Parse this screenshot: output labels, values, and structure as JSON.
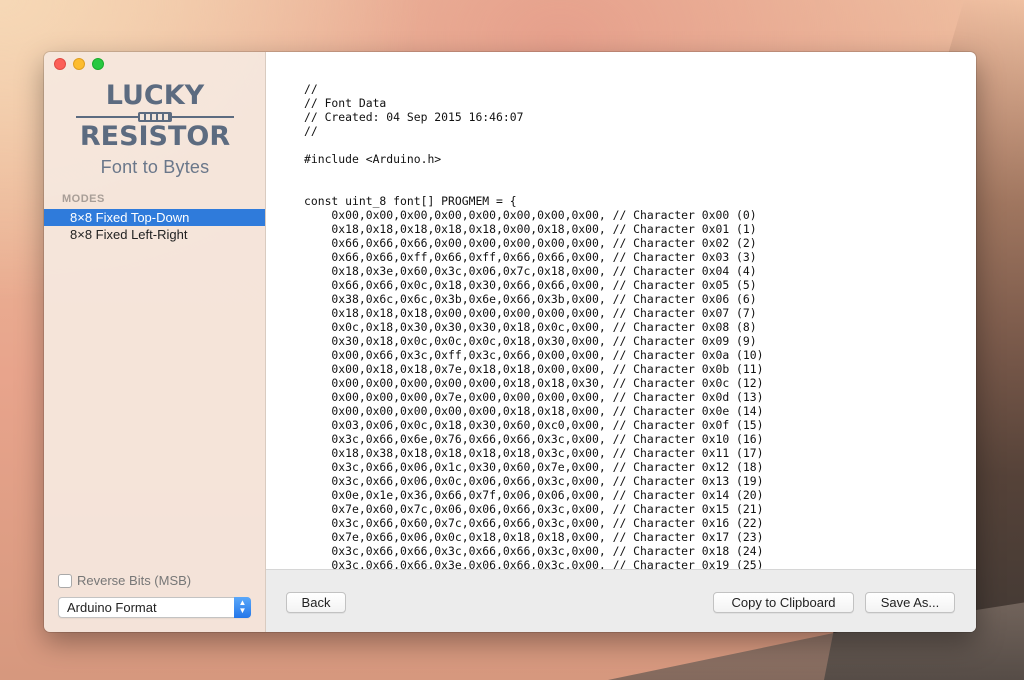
{
  "logo": {
    "line1": "LUCKY",
    "line2": "RESISTOR",
    "subtitle": "Font to Bytes"
  },
  "sidebar": {
    "modes_heading": "MODES",
    "modes": [
      {
        "label": "8×8 Fixed Top-Down",
        "selected": true
      },
      {
        "label": "8×8 Fixed Left-Right",
        "selected": false
      }
    ],
    "reverse_bits_label": "Reverse Bits (MSB)",
    "reverse_bits_checked": false,
    "format_value": "Arduino Format"
  },
  "code_lines": [
    "//",
    "// Font Data",
    "// Created: 04 Sep 2015 16:46:07",
    "//",
    "",
    "#include <Arduino.h>",
    "",
    "",
    "const uint_8 font[] PROGMEM = {",
    "    0x00,0x00,0x00,0x00,0x00,0x00,0x00,0x00, // Character 0x00 (0)",
    "    0x18,0x18,0x18,0x18,0x18,0x00,0x18,0x00, // Character 0x01 (1)",
    "    0x66,0x66,0x66,0x00,0x00,0x00,0x00,0x00, // Character 0x02 (2)",
    "    0x66,0x66,0xff,0x66,0xff,0x66,0x66,0x00, // Character 0x03 (3)",
    "    0x18,0x3e,0x60,0x3c,0x06,0x7c,0x18,0x00, // Character 0x04 (4)",
    "    0x66,0x66,0x0c,0x18,0x30,0x66,0x66,0x00, // Character 0x05 (5)",
    "    0x38,0x6c,0x6c,0x3b,0x6e,0x66,0x3b,0x00, // Character 0x06 (6)",
    "    0x18,0x18,0x18,0x00,0x00,0x00,0x00,0x00, // Character 0x07 (7)",
    "    0x0c,0x18,0x30,0x30,0x30,0x18,0x0c,0x00, // Character 0x08 (8)",
    "    0x30,0x18,0x0c,0x0c,0x0c,0x18,0x30,0x00, // Character 0x09 (9)",
    "    0x00,0x66,0x3c,0xff,0x3c,0x66,0x00,0x00, // Character 0x0a (10)",
    "    0x00,0x18,0x18,0x7e,0x18,0x18,0x00,0x00, // Character 0x0b (11)",
    "    0x00,0x00,0x00,0x00,0x00,0x18,0x18,0x30, // Character 0x0c (12)",
    "    0x00,0x00,0x00,0x7e,0x00,0x00,0x00,0x00, // Character 0x0d (13)",
    "    0x00,0x00,0x00,0x00,0x00,0x18,0x18,0x00, // Character 0x0e (14)",
    "    0x03,0x06,0x0c,0x18,0x30,0x60,0xc0,0x00, // Character 0x0f (15)",
    "    0x3c,0x66,0x6e,0x76,0x66,0x66,0x3c,0x00, // Character 0x10 (16)",
    "    0x18,0x38,0x18,0x18,0x18,0x18,0x3c,0x00, // Character 0x11 (17)",
    "    0x3c,0x66,0x06,0x1c,0x30,0x60,0x7e,0x00, // Character 0x12 (18)",
    "    0x3c,0x66,0x06,0x0c,0x06,0x66,0x3c,0x00, // Character 0x13 (19)",
    "    0x0e,0x1e,0x36,0x66,0x7f,0x06,0x06,0x00, // Character 0x14 (20)",
    "    0x7e,0x60,0x7c,0x06,0x06,0x66,0x3c,0x00, // Character 0x15 (21)",
    "    0x3c,0x66,0x60,0x7c,0x66,0x66,0x3c,0x00, // Character 0x16 (22)",
    "    0x7e,0x66,0x06,0x0c,0x18,0x18,0x18,0x00, // Character 0x17 (23)",
    "    0x3c,0x66,0x66,0x3c,0x66,0x66,0x3c,0x00, // Character 0x18 (24)",
    "    0x3c,0x66,0x66,0x3e,0x06,0x66,0x3c,0x00, // Character 0x19 (25)"
  ],
  "footer": {
    "back_label": "Back",
    "copy_label": "Copy to Clipboard",
    "save_label": "Save As..."
  },
  "icons": {
    "close": "close-icon",
    "minimize": "minimize-icon",
    "zoom": "zoom-icon",
    "stepper": "chevron-updown-icon"
  },
  "colors": {
    "selection": "#2f7bdb",
    "logo": "#5c6b80"
  }
}
